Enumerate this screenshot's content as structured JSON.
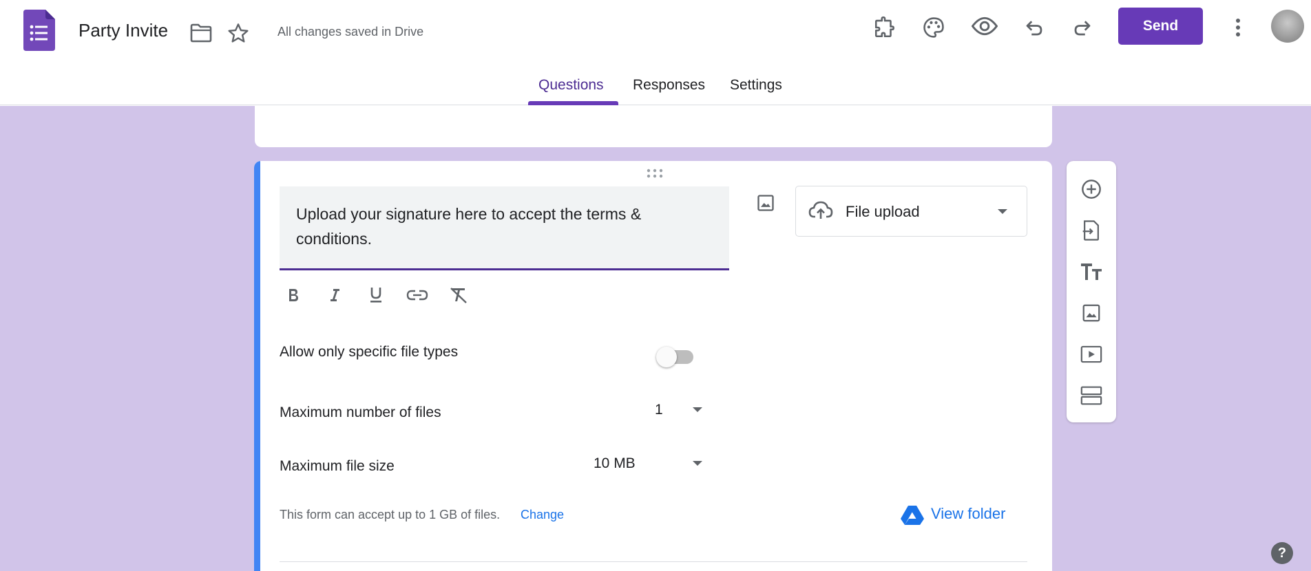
{
  "header": {
    "title": "Party Invite",
    "save_status": "All changes saved in Drive",
    "send_label": "Send",
    "icons": [
      "forms-logo-icon",
      "folder-icon",
      "star-icon",
      "addons-puzzle-icon",
      "palette-icon",
      "preview-eye-icon",
      "undo-icon",
      "redo-icon",
      "more-vert-icon",
      "avatar"
    ]
  },
  "tabs": [
    {
      "label": "Questions",
      "active": true
    },
    {
      "label": "Responses",
      "active": false
    },
    {
      "label": "Settings",
      "active": false
    }
  ],
  "question": {
    "text": "Upload your signature here to accept the terms & conditions.",
    "type_label": "File upload",
    "format_tools": [
      "bold-icon",
      "italic-icon",
      "underline-icon",
      "link-icon",
      "clear-format-icon"
    ],
    "allow_specific_types_label": "Allow only specific file types",
    "allow_specific_types_on": false,
    "max_files_label": "Maximum number of files",
    "max_files_value": "1",
    "max_size_label": "Maximum file size",
    "max_size_value": "10 MB",
    "footnote": "This form can accept up to 1 GB of files.",
    "change_label": "Change",
    "view_folder_label": "View folder"
  },
  "sidebar": {
    "tools": [
      "add-question-icon",
      "import-questions-icon",
      "add-title-icon",
      "add-image-icon",
      "add-video-icon",
      "add-section-icon"
    ]
  },
  "help_label": "?",
  "colors": {
    "accent": "#673ab7",
    "canvas": "#d1c4e9",
    "question_bar": "#4285f4",
    "link": "#1a73e8"
  }
}
